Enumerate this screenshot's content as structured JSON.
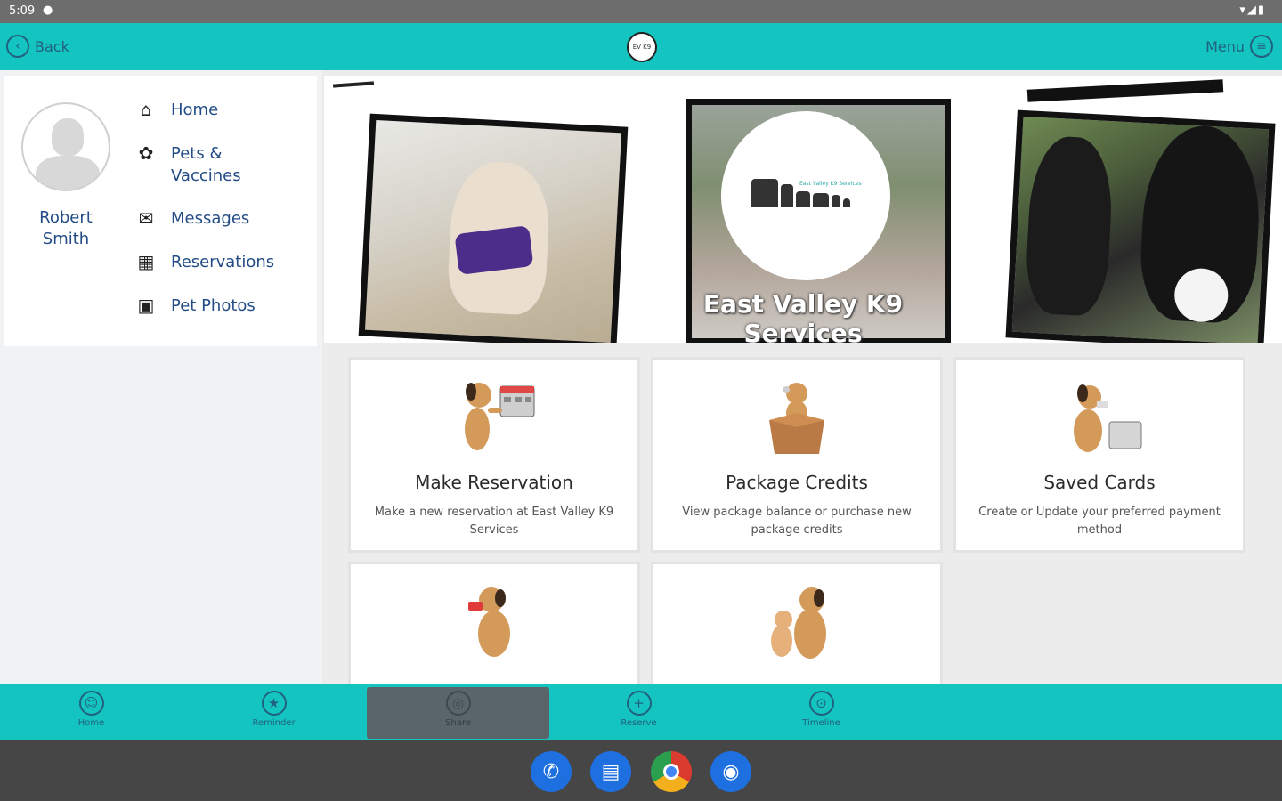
{
  "status_bar": {
    "time": "5:09",
    "message_icon": "chat-bubble-icon",
    "right_icons": "▾◢▮"
  },
  "app_bar": {
    "back_label": "Back",
    "menu_label": "Menu",
    "logo_text": "EV K9"
  },
  "profile": {
    "first_name": "Robert",
    "last_name": "Smith",
    "nav": [
      {
        "label": "Home",
        "icon": "house-icon"
      },
      {
        "label": "Pets &\nVaccines",
        "icon": "paw-icon"
      },
      {
        "label": "Messages",
        "icon": "envelope-icon"
      },
      {
        "label": "Reservations",
        "icon": "calendar-icon"
      },
      {
        "label": "Pet Photos",
        "icon": "photos-icon"
      }
    ]
  },
  "banner": {
    "title": "East Valley K9 Services",
    "logo_small_text": "East Valley K9 Services"
  },
  "tiles": [
    {
      "title": "Make Reservation",
      "description": "Make a new reservation at East Valley K9 Services",
      "icon": "dog-calendar-icon"
    },
    {
      "title": "Package Credits",
      "description": "View package balance or purchase new package credits",
      "icon": "dog-box-icon"
    },
    {
      "title": "Saved Cards",
      "description": "Create or Update your preferred payment method",
      "icon": "dog-card-icon"
    },
    {
      "title": "",
      "description": "",
      "icon": "dog-treat-icon"
    },
    {
      "title": "",
      "description": "",
      "icon": "dog-puppy-icon"
    }
  ],
  "tabbar": [
    {
      "label": "Home",
      "icon": "person-icon",
      "active": false
    },
    {
      "label": "Reminder",
      "icon": "star-icon",
      "active": false
    },
    {
      "label": "Share",
      "icon": "share-icon",
      "active": true
    },
    {
      "label": "Reserve",
      "icon": "plus-icon",
      "active": false
    },
    {
      "label": "Timeline",
      "icon": "timeline-icon",
      "active": false
    }
  ],
  "dock": [
    {
      "app": "Phone",
      "icon": "phone-icon"
    },
    {
      "app": "Messages",
      "icon": "chat-icon"
    },
    {
      "app": "Chrome",
      "icon": "chrome-icon"
    },
    {
      "app": "Camera",
      "icon": "camera-icon"
    }
  ],
  "colors": {
    "accent": "#14c4c0",
    "text_link": "#234c86",
    "icon_dark": "#21617f",
    "tab_active": "#5a6569"
  }
}
